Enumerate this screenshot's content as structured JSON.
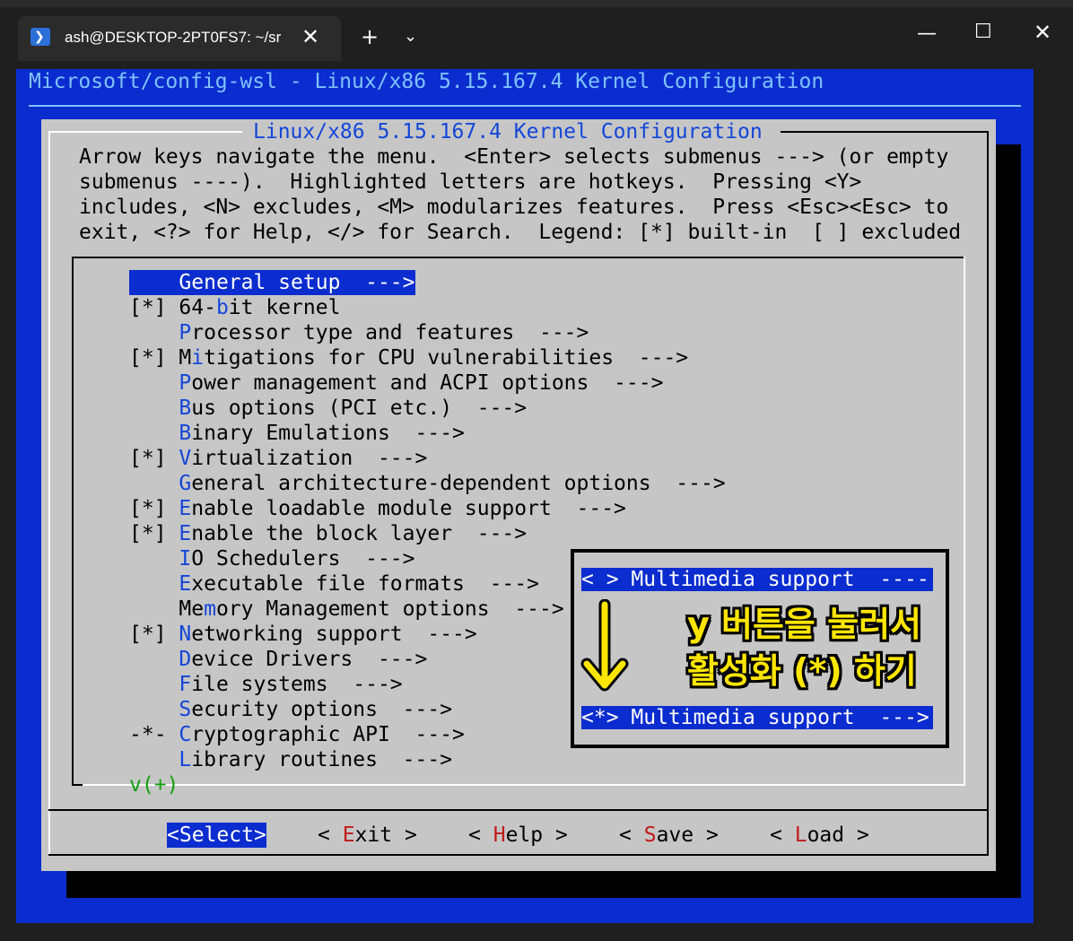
{
  "window": {
    "tab_title": "ash@DESKTOP-2PT0FS7: ~/sr",
    "tab_icon": "powershell-icon",
    "close_tab_glyph": "✕",
    "new_tab_glyph": "+",
    "dropdown_glyph": "⌄",
    "minimize_glyph": "—",
    "maximize_glyph": "☐",
    "close_glyph": "✕"
  },
  "terminal": {
    "header": "Microsoft/config-wsl - Linux/x86 5.15.167.4 Kernel Configuration",
    "background_color": "#0b2ccf"
  },
  "dialog": {
    "title": "Linux/x86 5.15.167.4 Kernel Configuration",
    "help_lines": [
      "Arrow keys navigate the menu.  <Enter> selects submenus ---> (or empty",
      "submenus ----).  Highlighted letters are hotkeys.  Pressing <Y>",
      "includes, <N> excludes, <M> modularizes features.  Press <Esc><Esc> to",
      "exit, <?> for Help, </> for Search.  Legend: [*] built-in  [ ] excluded"
    ],
    "menu_items": [
      {
        "prefix": "    ",
        "pre": "",
        "hotkey": "G",
        "post": "eneral setup  --->",
        "selected": true
      },
      {
        "prefix": "[*] ",
        "pre": "64-",
        "hotkey": "b",
        "post": "it kernel",
        "selected": false
      },
      {
        "prefix": "    ",
        "pre": "",
        "hotkey": "P",
        "post": "rocessor type and features  --->",
        "selected": false
      },
      {
        "prefix": "[*] ",
        "pre": "M",
        "hotkey": "i",
        "post": "tigations for CPU vulnerabilities  --->",
        "selected": false
      },
      {
        "prefix": "    ",
        "pre": "",
        "hotkey": "P",
        "post": "ower management and ACPI options  --->",
        "selected": false
      },
      {
        "prefix": "    ",
        "pre": "",
        "hotkey": "B",
        "post": "us options (PCI etc.)  --->",
        "selected": false
      },
      {
        "prefix": "    ",
        "pre": "",
        "hotkey": "B",
        "post": "inary Emulations  --->",
        "selected": false
      },
      {
        "prefix": "[*] ",
        "pre": "",
        "hotkey": "V",
        "post": "irtualization  --->",
        "selected": false
      },
      {
        "prefix": "    ",
        "pre": "",
        "hotkey": "G",
        "post": "eneral architecture-dependent options  --->",
        "selected": false
      },
      {
        "prefix": "[*] ",
        "pre": "",
        "hotkey": "E",
        "post": "nable loadable module support  --->",
        "selected": false
      },
      {
        "prefix": "[*] ",
        "pre": "",
        "hotkey": "E",
        "post": "nable the block layer  --->",
        "selected": false
      },
      {
        "prefix": "    ",
        "pre": "",
        "hotkey": "I",
        "post": "O Schedulers  --->",
        "selected": false
      },
      {
        "prefix": "    ",
        "pre": "",
        "hotkey": "E",
        "post": "xecutable file formats  --->",
        "selected": false
      },
      {
        "prefix": "    ",
        "pre": "Me",
        "hotkey": "m",
        "post": "ory Management options  --->",
        "selected": false
      },
      {
        "prefix": "[*] ",
        "pre": "",
        "hotkey": "N",
        "post": "etworking support  --->",
        "selected": false
      },
      {
        "prefix": "    ",
        "pre": "",
        "hotkey": "D",
        "post": "evice Drivers  --->",
        "selected": false
      },
      {
        "prefix": "    ",
        "pre": "",
        "hotkey": "F",
        "post": "ile systems  --->",
        "selected": false
      },
      {
        "prefix": "    ",
        "pre": "",
        "hotkey": "S",
        "post": "ecurity options  --->",
        "selected": false
      },
      {
        "prefix": "-*- ",
        "pre": "",
        "hotkey": "C",
        "post": "ryptographic API  --->",
        "selected": false
      },
      {
        "prefix": "    ",
        "pre": "",
        "hotkey": "L",
        "post": "ibrary routines  --->",
        "selected": false
      }
    ],
    "more_indicator": "v(+)",
    "buttons": [
      {
        "pre": "<",
        "hotkey": "",
        "post": "Select>",
        "selected": true
      },
      {
        "pre": "< ",
        "hotkey": "E",
        "post": "xit >",
        "selected": false
      },
      {
        "pre": "< ",
        "hotkey": "H",
        "post": "elp >",
        "selected": false
      },
      {
        "pre": "< ",
        "hotkey": "S",
        "post": "ave >",
        "selected": false
      },
      {
        "pre": "< ",
        "hotkey": "L",
        "post": "oad >",
        "selected": false
      }
    ]
  },
  "annotation": {
    "before": "< > Multimedia support  ----",
    "after": "<*> Multimedia support  --->",
    "line1": "y 버튼을 눌러서",
    "line2": "활성화 (*) 하기",
    "arrow_icon": "down-arrow-icon",
    "text_color": "#ffe600"
  }
}
